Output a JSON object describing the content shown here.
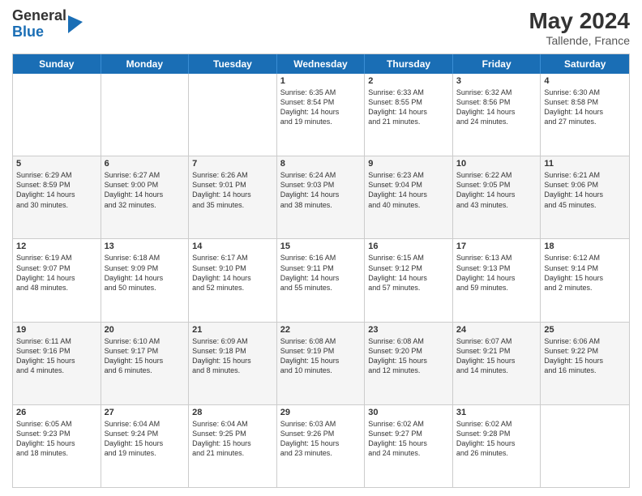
{
  "header": {
    "logo_line1": "General",
    "logo_line2": "Blue",
    "month_year": "May 2024",
    "location": "Tallende, France"
  },
  "days_of_week": [
    "Sunday",
    "Monday",
    "Tuesday",
    "Wednesday",
    "Thursday",
    "Friday",
    "Saturday"
  ],
  "weeks": [
    [
      {
        "day": "",
        "info": ""
      },
      {
        "day": "",
        "info": ""
      },
      {
        "day": "",
        "info": ""
      },
      {
        "day": "1",
        "info": "Sunrise: 6:35 AM\nSunset: 8:54 PM\nDaylight: 14 hours\nand 19 minutes."
      },
      {
        "day": "2",
        "info": "Sunrise: 6:33 AM\nSunset: 8:55 PM\nDaylight: 14 hours\nand 21 minutes."
      },
      {
        "day": "3",
        "info": "Sunrise: 6:32 AM\nSunset: 8:56 PM\nDaylight: 14 hours\nand 24 minutes."
      },
      {
        "day": "4",
        "info": "Sunrise: 6:30 AM\nSunset: 8:58 PM\nDaylight: 14 hours\nand 27 minutes."
      }
    ],
    [
      {
        "day": "5",
        "info": "Sunrise: 6:29 AM\nSunset: 8:59 PM\nDaylight: 14 hours\nand 30 minutes."
      },
      {
        "day": "6",
        "info": "Sunrise: 6:27 AM\nSunset: 9:00 PM\nDaylight: 14 hours\nand 32 minutes."
      },
      {
        "day": "7",
        "info": "Sunrise: 6:26 AM\nSunset: 9:01 PM\nDaylight: 14 hours\nand 35 minutes."
      },
      {
        "day": "8",
        "info": "Sunrise: 6:24 AM\nSunset: 9:03 PM\nDaylight: 14 hours\nand 38 minutes."
      },
      {
        "day": "9",
        "info": "Sunrise: 6:23 AM\nSunset: 9:04 PM\nDaylight: 14 hours\nand 40 minutes."
      },
      {
        "day": "10",
        "info": "Sunrise: 6:22 AM\nSunset: 9:05 PM\nDaylight: 14 hours\nand 43 minutes."
      },
      {
        "day": "11",
        "info": "Sunrise: 6:21 AM\nSunset: 9:06 PM\nDaylight: 14 hours\nand 45 minutes."
      }
    ],
    [
      {
        "day": "12",
        "info": "Sunrise: 6:19 AM\nSunset: 9:07 PM\nDaylight: 14 hours\nand 48 minutes."
      },
      {
        "day": "13",
        "info": "Sunrise: 6:18 AM\nSunset: 9:09 PM\nDaylight: 14 hours\nand 50 minutes."
      },
      {
        "day": "14",
        "info": "Sunrise: 6:17 AM\nSunset: 9:10 PM\nDaylight: 14 hours\nand 52 minutes."
      },
      {
        "day": "15",
        "info": "Sunrise: 6:16 AM\nSunset: 9:11 PM\nDaylight: 14 hours\nand 55 minutes."
      },
      {
        "day": "16",
        "info": "Sunrise: 6:15 AM\nSunset: 9:12 PM\nDaylight: 14 hours\nand 57 minutes."
      },
      {
        "day": "17",
        "info": "Sunrise: 6:13 AM\nSunset: 9:13 PM\nDaylight: 14 hours\nand 59 minutes."
      },
      {
        "day": "18",
        "info": "Sunrise: 6:12 AM\nSunset: 9:14 PM\nDaylight: 15 hours\nand 2 minutes."
      }
    ],
    [
      {
        "day": "19",
        "info": "Sunrise: 6:11 AM\nSunset: 9:16 PM\nDaylight: 15 hours\nand 4 minutes."
      },
      {
        "day": "20",
        "info": "Sunrise: 6:10 AM\nSunset: 9:17 PM\nDaylight: 15 hours\nand 6 minutes."
      },
      {
        "day": "21",
        "info": "Sunrise: 6:09 AM\nSunset: 9:18 PM\nDaylight: 15 hours\nand 8 minutes."
      },
      {
        "day": "22",
        "info": "Sunrise: 6:08 AM\nSunset: 9:19 PM\nDaylight: 15 hours\nand 10 minutes."
      },
      {
        "day": "23",
        "info": "Sunrise: 6:08 AM\nSunset: 9:20 PM\nDaylight: 15 hours\nand 12 minutes."
      },
      {
        "day": "24",
        "info": "Sunrise: 6:07 AM\nSunset: 9:21 PM\nDaylight: 15 hours\nand 14 minutes."
      },
      {
        "day": "25",
        "info": "Sunrise: 6:06 AM\nSunset: 9:22 PM\nDaylight: 15 hours\nand 16 minutes."
      }
    ],
    [
      {
        "day": "26",
        "info": "Sunrise: 6:05 AM\nSunset: 9:23 PM\nDaylight: 15 hours\nand 18 minutes."
      },
      {
        "day": "27",
        "info": "Sunrise: 6:04 AM\nSunset: 9:24 PM\nDaylight: 15 hours\nand 19 minutes."
      },
      {
        "day": "28",
        "info": "Sunrise: 6:04 AM\nSunset: 9:25 PM\nDaylight: 15 hours\nand 21 minutes."
      },
      {
        "day": "29",
        "info": "Sunrise: 6:03 AM\nSunset: 9:26 PM\nDaylight: 15 hours\nand 23 minutes."
      },
      {
        "day": "30",
        "info": "Sunrise: 6:02 AM\nSunset: 9:27 PM\nDaylight: 15 hours\nand 24 minutes."
      },
      {
        "day": "31",
        "info": "Sunrise: 6:02 AM\nSunset: 9:28 PM\nDaylight: 15 hours\nand 26 minutes."
      },
      {
        "day": "",
        "info": ""
      }
    ]
  ]
}
